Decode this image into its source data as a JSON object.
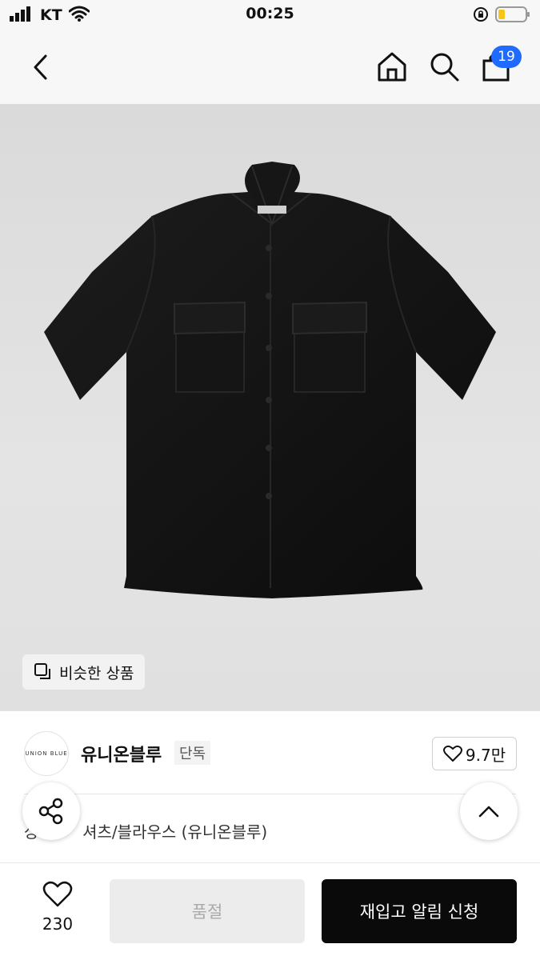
{
  "status_bar": {
    "carrier": "KT",
    "time": "00:25",
    "signal_icon": "signal-icon",
    "wifi_icon": "wifi-icon",
    "battery_icon": "battery-icon"
  },
  "nav": {
    "back_icon": "chevron-left-icon",
    "home_icon": "home-icon",
    "search_icon": "search-icon",
    "cart_icon": "shopping-bag-icon",
    "cart_count": "19"
  },
  "product": {
    "image_alt": "black short-sleeve shirt",
    "similar_label": "비슷한 상품"
  },
  "brand": {
    "logo_text": "UNION BLUE",
    "name": "유니온블루",
    "tag": "단독",
    "like_count": "9.7만"
  },
  "category": {
    "prefix": "상",
    "text": "셔츠/블라우스 (유니온블루)"
  },
  "bottom": {
    "wish_count": "230",
    "soldout_label": "품절",
    "restock_label": "재입고 알림 신청"
  },
  "colors": {
    "badge": "#1f6bff",
    "primary_button": "#0a0a0a"
  }
}
